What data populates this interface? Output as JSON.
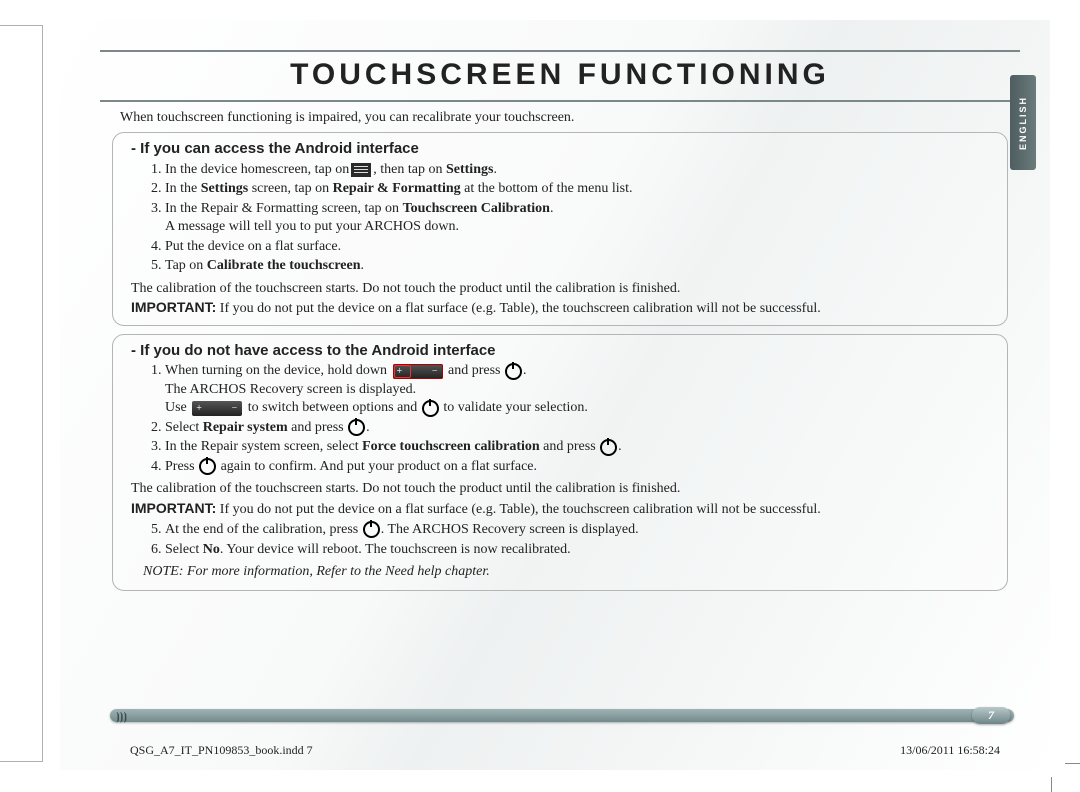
{
  "title": "TOUCHSCREEN FUNCTIONING",
  "language_tab": "ENGLISH",
  "intro": "When touchscreen functioning is impaired, you can recalibrate your touchscreen.",
  "section_a": {
    "heading": "If you can access the Android interface",
    "step1_a": "In the device homescreen, tap on",
    "step1_b": ", then tap on ",
    "step1_bold": "Settings",
    "step1_c": ".",
    "step2_a": "In the ",
    "step2_b1": "Settings",
    "step2_b": " screen, tap on ",
    "step2_b2": "Repair & Formatting",
    "step2_c": " at the bottom of the menu list.",
    "step3_a": "In the Repair & Formatting screen, tap on ",
    "step3_bold": "Touchscreen Calibration",
    "step3_b": ".",
    "step3_sub": "A message will tell you to put your ARCHOS down.",
    "step4": "Put the device on a flat surface.",
    "step5_a": "Tap on ",
    "step5_bold": "Calibrate the touchscreen",
    "step5_b": ".",
    "calib": "The calibration of the touchscreen starts. Do not touch the product until the calibration is finished.",
    "important_lead": "IMPORTANT:",
    "important": " If you do not put the device on a flat surface (e.g. Table), the touchscreen calibration will not be successful."
  },
  "section_b": {
    "heading": "If you do not have access to the Android interface",
    "step1_a": "When turning on the device, hold down ",
    "step1_b": " and press ",
    "step1_c": ".",
    "step1_sub1": "The ARCHOS Recovery screen is displayed.",
    "step1_sub2a": "Use ",
    "step1_sub2b": " to switch between options and ",
    "step1_sub2c": " to validate your selection.",
    "step2_a": "Select ",
    "step2_bold": "Repair system",
    "step2_b": " and press ",
    "step2_c": ".",
    "step3_a": "In the Repair system screen, select ",
    "step3_bold": "Force touchscreen calibration",
    "step3_b": " and press ",
    "step3_c": ".",
    "step4_a": "Press ",
    "step4_b": " again to confirm. And put your product on a flat surface.",
    "calib": "The calibration of the touchscreen starts. Do not touch the product until the calibration is finished.",
    "important_lead": "IMPORTANT:",
    "important": " If you do not put the device on a flat surface (e.g. Table), the touchscreen calibration will not be successful.",
    "step5_a": "At the end of the calibration, press ",
    "step5_b": ". The ARCHOS Recovery screen is displayed.",
    "step6_a": "Select ",
    "step6_bold": "No",
    "step6_b": ". Your device will reboot. The touchscreen is now recalibrated."
  },
  "note": "NOTE: For more information, Refer to the Need help chapter.",
  "page_number": "7",
  "slug": "QSG_A7_IT_PN109853_book.indd   7",
  "timestamp": "13/06/2011   16:58:24"
}
